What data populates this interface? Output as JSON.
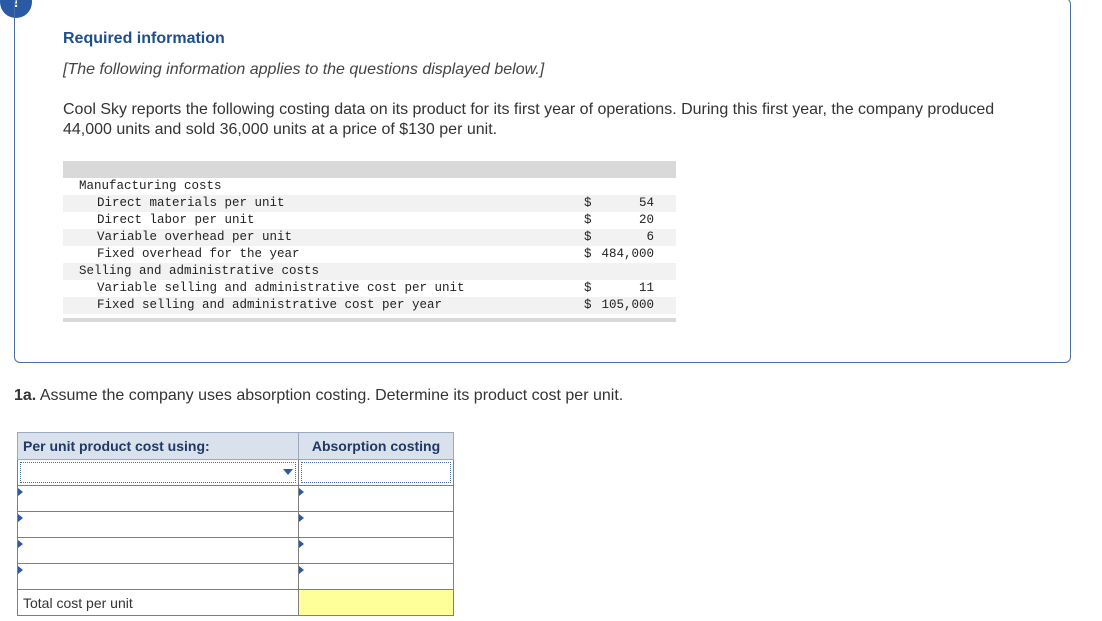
{
  "alert_badge": "!",
  "required_info": {
    "title": "Required information",
    "subtitle": "[The following information applies to the questions displayed below.]",
    "intro": "Cool Sky reports the following costing data on its product for its first year of operations. During this first year, the company produced 44,000 units and sold 36,000 units at a price of $130 per unit."
  },
  "cost_data": {
    "rows": [
      {
        "label": "Manufacturing costs",
        "dollar": "",
        "amount": ""
      },
      {
        "label": "Direct materials per unit",
        "dollar": "$",
        "amount": "54"
      },
      {
        "label": "Direct labor per unit",
        "dollar": "$",
        "amount": "20"
      },
      {
        "label": "Variable overhead per unit",
        "dollar": "$",
        "amount": "6"
      },
      {
        "label": "Fixed overhead for the year",
        "dollar": "$",
        "amount": "484,000"
      },
      {
        "label": "Selling and administrative costs",
        "dollar": "",
        "amount": ""
      },
      {
        "label": "Variable selling and administrative cost per unit",
        "dollar": "$",
        "amount": "11"
      },
      {
        "label": "Fixed selling and administrative cost per year",
        "dollar": "$",
        "amount": "105,000"
      }
    ]
  },
  "question": {
    "number": "1a.",
    "text": " Assume the company uses absorption costing. Determine its product cost per unit."
  },
  "answer_table": {
    "header_left": "Per unit product cost using:",
    "header_right": "Absorption costing",
    "total_label": "Total cost per unit"
  }
}
